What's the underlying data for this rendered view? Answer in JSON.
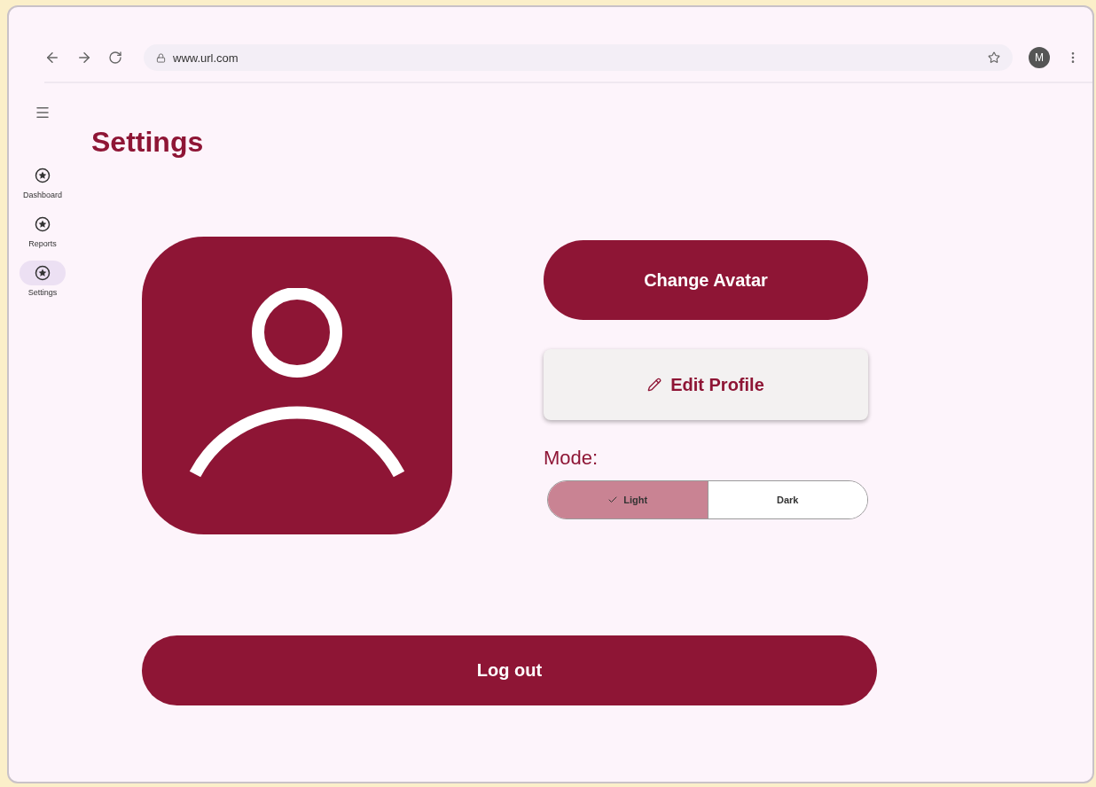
{
  "browser": {
    "url": "www.url.com",
    "profile_initial": "M"
  },
  "nav": [
    {
      "label": "Dashboard",
      "selected": false
    },
    {
      "label": "Reports",
      "selected": false
    },
    {
      "label": "Settings",
      "selected": true
    }
  ],
  "page": {
    "title": "Settings"
  },
  "actions": {
    "change_avatar": "Change Avatar",
    "edit_profile": "Edit Profile"
  },
  "mode": {
    "label": "Mode:",
    "options": [
      {
        "label": "Light",
        "selected": true
      },
      {
        "label": "Dark",
        "selected": false
      }
    ]
  },
  "logout": "Log out"
}
